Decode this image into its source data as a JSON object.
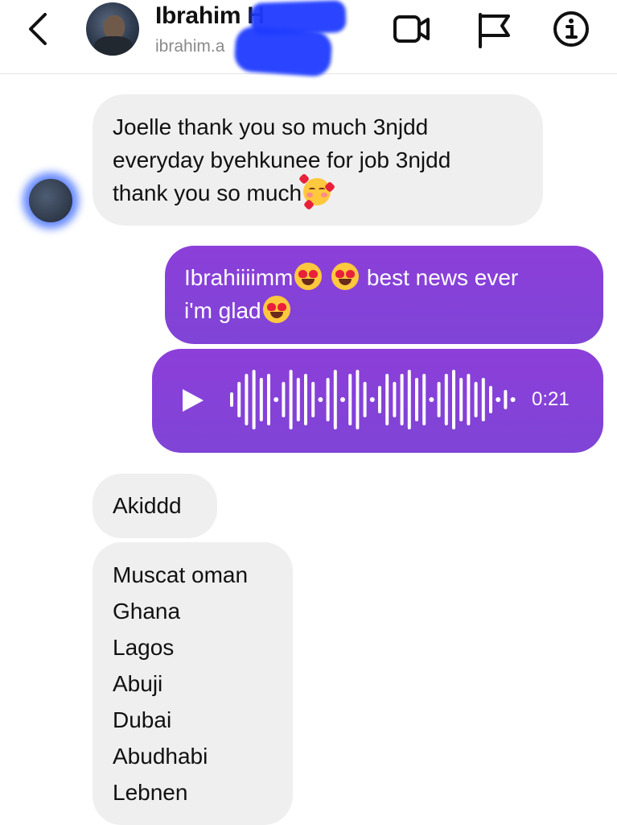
{
  "header": {
    "name": "Ibrahim H",
    "username": "ibrahim.a",
    "icons": [
      "chevron-left-icon",
      "video-camera-icon",
      "flag-icon",
      "info-icon"
    ]
  },
  "messages": {
    "m1": {
      "line1": "Joelle thank you so much 3njdd",
      "line2": "everyday byehkunee for job 3njdd",
      "line3": "thank you so much"
    },
    "m2": {
      "line1_a": "Ibrahiiiimm",
      "line1_b": "best news ever",
      "line2": "i'm glad"
    },
    "voice": {
      "duration": "0:21"
    },
    "m3": "Akiddd",
    "m4": [
      "Muscat oman",
      "Ghana",
      "Lagos",
      "Abuji",
      "Dubai",
      "Abudhabi",
      "Lebnen"
    ]
  },
  "colors": {
    "outgoing_bubble": "#8a40d8",
    "incoming_bubble": "#efefef",
    "redaction": "#1f3bff"
  }
}
